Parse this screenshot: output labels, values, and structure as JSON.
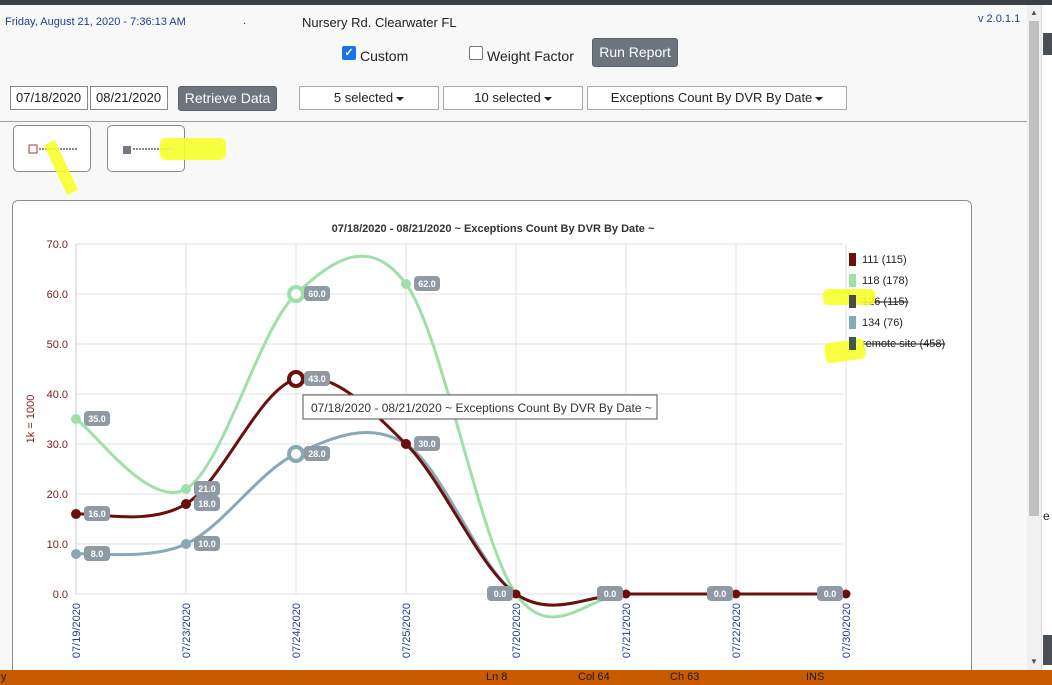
{
  "header": {
    "datetime": "Friday, August 21, 2020 - 7:36:13 AM",
    "dot": ".",
    "location": "Nursery Rd. Clearwater FL",
    "version": "v 2.0.1.1"
  },
  "controls": {
    "custom_label": "Custom",
    "custom_checked": true,
    "weight_label": "Weight Factor",
    "weight_checked": false,
    "run_report": "Run Report",
    "start_date": "07/18/2020",
    "end_date": "08/21/2020",
    "retrieve": "Retrieve Data",
    "dropdown1": "5 selected",
    "dropdown2": "10 selected",
    "dropdown3": "Exceptions Count By DVR By Date"
  },
  "tooltip": "07/18/2020 - 08/21/2020 ~ Exceptions Count By DVR By Date ~",
  "status": {
    "left": "y",
    "ln": "Ln 8",
    "col": "Col 64",
    "ch": "Ch 63",
    "ins": "INS"
  },
  "chart_data": {
    "type": "line",
    "title": "07/18/2020 - 08/21/2020 ~ Exceptions Count By DVR By Date ~",
    "ylabel": "1k = 1000",
    "xlabel": "",
    "ylim": [
      0,
      70
    ],
    "yticks": [
      "0.0",
      "10.0",
      "20.0",
      "30.0",
      "40.0",
      "50.0",
      "60.0",
      "70.0"
    ],
    "categories": [
      "07/19/2020",
      "07/23/2020",
      "07/24/2020",
      "07/25/2020",
      "07/20/2020",
      "07/21/2020",
      "07/22/2020",
      "07/30/2020"
    ],
    "grid": true,
    "legend_position": "right",
    "series": [
      {
        "name": "111 (115)",
        "color": "#6b0f0f",
        "hidden": false,
        "values": [
          16,
          18,
          43,
          30,
          0,
          0,
          0,
          0
        ]
      },
      {
        "name": "118 (178)",
        "color": "#9fe0a8",
        "hidden": false,
        "values": [
          35,
          21,
          60,
          62,
          0,
          0,
          0,
          0
        ]
      },
      {
        "name": "126 (115)",
        "color": "#4a4a4a",
        "hidden": true,
        "values": []
      },
      {
        "name": "134 (76)",
        "color": "#88a9b4",
        "hidden": false,
        "values": [
          8,
          10,
          28,
          30,
          0,
          0,
          0,
          0
        ]
      },
      {
        "name": "remote site (458)",
        "color": "#3c5a4a",
        "hidden": true,
        "values": []
      }
    ],
    "data_labels": [
      {
        "series": 0,
        "index": 0,
        "text": "16.0"
      },
      {
        "series": 0,
        "index": 1,
        "text": "18.0"
      },
      {
        "series": 0,
        "index": 2,
        "text": "43.0"
      },
      {
        "series": 1,
        "index": 0,
        "text": "35.0"
      },
      {
        "series": 1,
        "index": 1,
        "text": "21.0"
      },
      {
        "series": 1,
        "index": 2,
        "text": "60.0"
      },
      {
        "series": 1,
        "index": 3,
        "text": "62.0"
      },
      {
        "series": 3,
        "index": 0,
        "text": "8.0"
      },
      {
        "series": 3,
        "index": 1,
        "text": "10.0"
      },
      {
        "series": 3,
        "index": 2,
        "text": "28.0"
      },
      {
        "series": 3,
        "index": 3,
        "text": "30.0"
      },
      {
        "series": 0,
        "index": 4,
        "text": "0.0"
      },
      {
        "series": 0,
        "index": 5,
        "text": "0.0"
      },
      {
        "series": 0,
        "index": 6,
        "text": "0.0"
      },
      {
        "series": 0,
        "index": 7,
        "text": "0.0"
      }
    ]
  }
}
